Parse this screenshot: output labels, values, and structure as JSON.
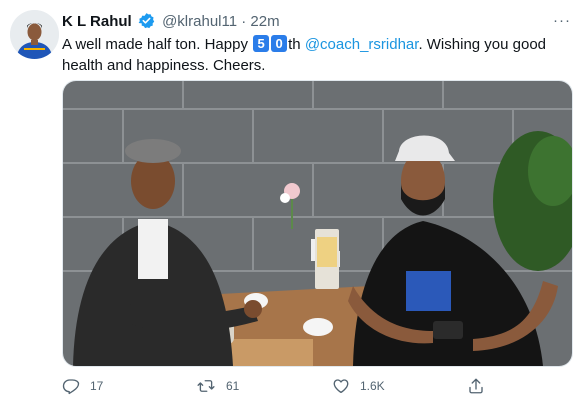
{
  "tweet": {
    "author_name": "K L Rahul",
    "handle": "@klrahul11",
    "separator": "·",
    "time": "22m",
    "more_label": "···",
    "text_before": "A well made half ton. Happy",
    "key_5": "5",
    "key_0": "0",
    "text_th": "th",
    "mention": "@coach_rsridhar",
    "text_after": ". Wishing you good health and happiness. Cheers.",
    "replies": "17",
    "retweets": "61",
    "likes": "1.6K"
  },
  "colors": {
    "accent": "#1b95e0",
    "muted": "#536471",
    "verified": "#1d9bf0"
  },
  "icons": [
    "verified-badge-icon",
    "reply-icon",
    "retweet-icon",
    "like-icon",
    "share-icon"
  ]
}
